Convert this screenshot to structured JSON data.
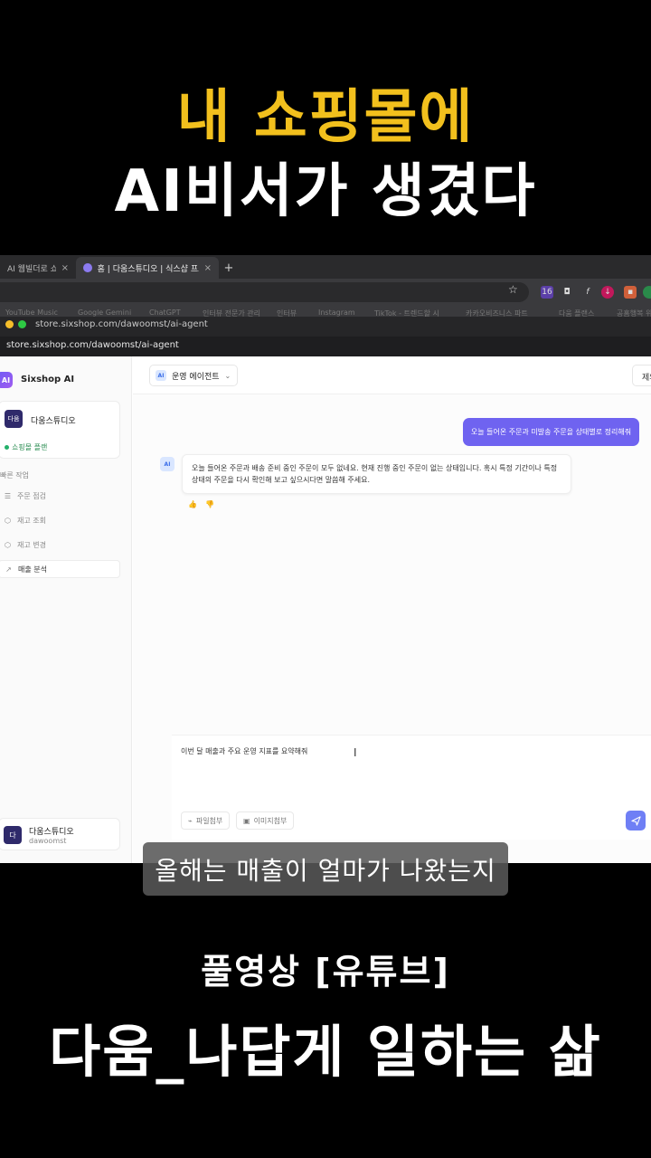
{
  "headline": {
    "line1": "내 쇼핑몰에",
    "line2": "AI비서가 생겼다"
  },
  "footer": {
    "line1": "풀영상 [유튜브]",
    "line2": "다움_나답게 일하는 삶"
  },
  "subtitle": "올해는 매출이 얼마가 나왔는지",
  "browser": {
    "tabs": [
      {
        "label": "AI 웹빌더로 쇼핑몰"
      },
      {
        "label": "홈 | 다움스튜디오 | 식스샵 프로"
      }
    ],
    "close_glyph": "×",
    "new_tab_glyph": "+",
    "bookmarks": [
      "YouTube Music",
      "Google Gemini",
      "ChatGPT",
      "인터뷰 전문가 관리",
      "인터뷰",
      "Instagram",
      "TikTok - 트렌드할 시",
      "카카오비즈니스 파트",
      "다움 플랜스",
      "공홈행복 위"
    ],
    "popup_url": "store.sixshop.com/dawoomst/ai-agent",
    "url": "store.sixshop.com/dawoomst/ai-agent",
    "extension_badge": "16",
    "accent": "#6f63f0"
  },
  "sidebar": {
    "logo": "AI",
    "brand": "Sixshop AI",
    "store": {
      "avatar": "다움",
      "name": "다움스튜디오",
      "plan": "쇼핑몰 플랜"
    },
    "section_label": "빠른 작업",
    "items": [
      {
        "label": "주문 점검",
        "icon": "list-icon"
      },
      {
        "label": "재고 조회",
        "icon": "box-icon"
      },
      {
        "label": "재고 변경",
        "icon": "box-icon"
      },
      {
        "label": "매출 분석",
        "icon": "chart-icon"
      }
    ],
    "user": {
      "avatar": "다",
      "name": "다움스튜디오",
      "id": "dawoomst"
    }
  },
  "chat": {
    "agent_chip": "AI",
    "agent_label": "운영 에이전트",
    "top_button": "제외",
    "user_message": "오늘 들어온 주문과 미발송 주문을 상태별로 정리해줘",
    "ai_avatar": "AI",
    "ai_message": "오늘 들어온 주문과 배송 준비 중인 주문이 모두 없네요. 현재 진행 중인 주문이 없는 상태입니다. 혹시 특정 기간이나 특정 상태의 주문을 다시 확인해 보고 싶으시다면 말씀해 주세요.",
    "reactions": [
      "👍",
      "👎"
    ],
    "input_value": "이번 달 매출과 주요 운영 지표를 요약해줘",
    "file_attach": "파일첨부",
    "image_attach": "이미지첨부"
  }
}
